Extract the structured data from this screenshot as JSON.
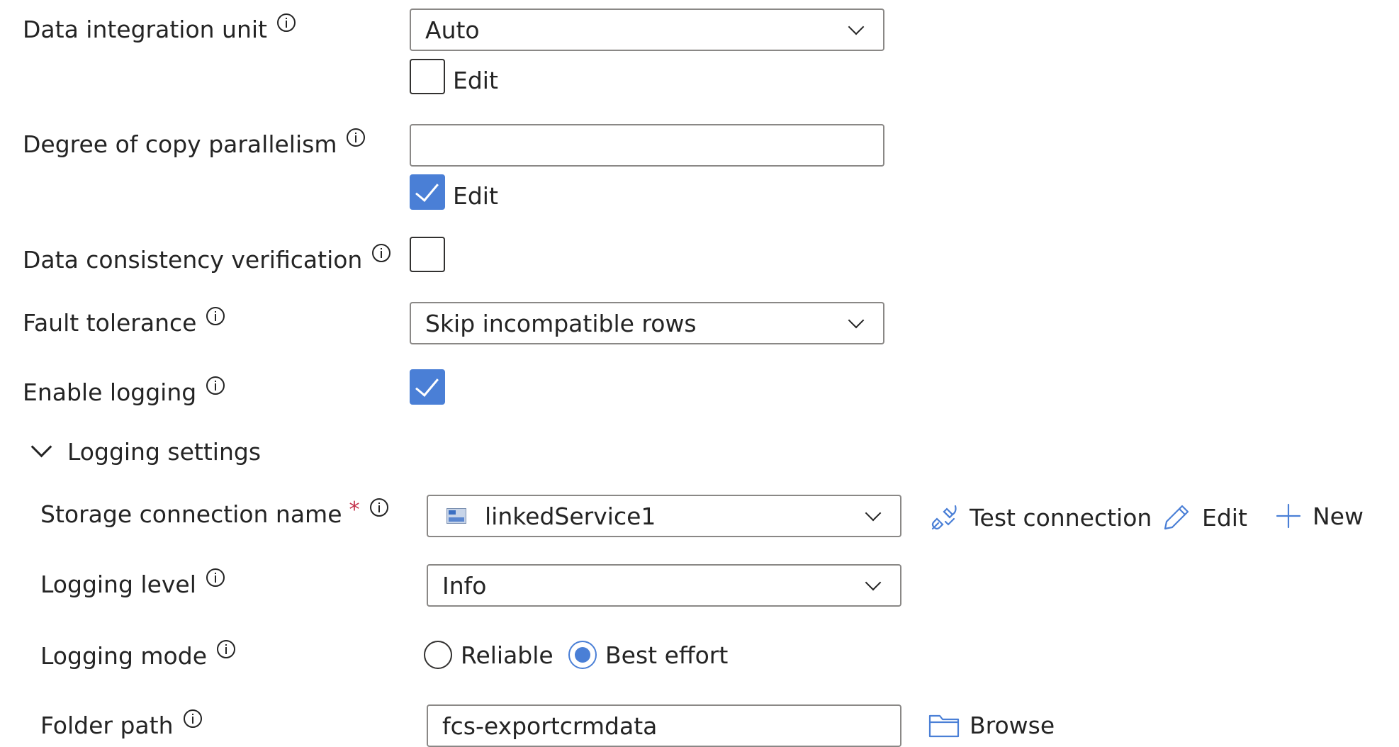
{
  "settings": {
    "diu": {
      "label": "Data integration unit",
      "value": "Auto",
      "edit_label": "Edit",
      "edit_checked": false
    },
    "parallelism": {
      "label": "Degree of copy parallelism",
      "value": "",
      "edit_label": "Edit",
      "edit_checked": true
    },
    "consistency": {
      "label": "Data consistency verification",
      "checked": false
    },
    "fault_tolerance": {
      "label": "Fault tolerance",
      "value": "Skip incompatible rows"
    },
    "enable_logging": {
      "label": "Enable logging",
      "checked": true
    }
  },
  "logging_settings": {
    "title": "Logging settings",
    "storage": {
      "label": "Storage connection name",
      "required_mark": "*",
      "value": "linkedService1",
      "test_connection": "Test connection",
      "edit": "Edit",
      "new": "New"
    },
    "level": {
      "label": "Logging level",
      "value": "Info"
    },
    "mode": {
      "label": "Logging mode",
      "options": [
        "Reliable",
        "Best effort"
      ],
      "selected": "Best effort"
    },
    "folder": {
      "label": "Folder path",
      "value": "fcs-exportcrmdata",
      "browse": "Browse"
    }
  },
  "colors": {
    "accent": "#4a7fd6",
    "required": "#c4314b",
    "text": "#242424",
    "border": "#8a8886"
  }
}
